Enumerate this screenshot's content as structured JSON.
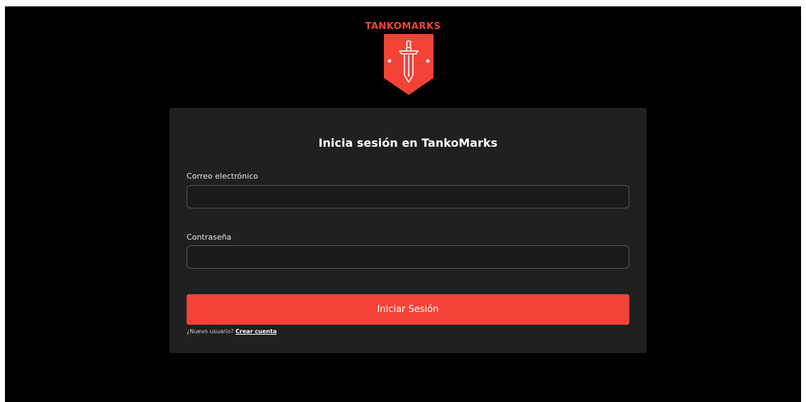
{
  "brand": {
    "name": "TANKOMARKS",
    "accent_color": "#f44336",
    "logo_icon": "sword-shield-icon"
  },
  "login": {
    "title": "Inicia sesión en TankoMarks",
    "email_label": "Correo electrónico",
    "email_value": "",
    "password_label": "Contraseña",
    "password_value": "",
    "submit_label": "Iniciar Sesión",
    "signup_prompt": "¿Nuevo usuario?",
    "signup_link": "Crear cuenta"
  },
  "colors": {
    "background": "#000000",
    "card": "#202020",
    "button": "#f44336"
  }
}
